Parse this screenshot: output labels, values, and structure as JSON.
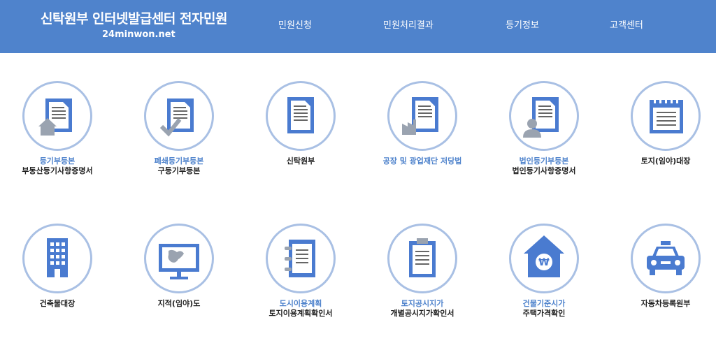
{
  "header": {
    "title": "신탁원부 인터넷발급센터 전자민원",
    "url": "24minwon.net",
    "nav": [
      "민원신청",
      "민원처리결과",
      "등기정보",
      "고객센터"
    ]
  },
  "services": [
    {
      "line1": "등기부등본",
      "line2": "부동산등기사항증명서",
      "icon": "house-document-icon"
    },
    {
      "line1": "폐쇄등기부등본",
      "line2": "구등기부등본",
      "icon": "checkmark-document-icon"
    },
    {
      "line1": "신탁원부",
      "line2": "",
      "icon": "document-icon"
    },
    {
      "line1": "공장 및 광업재단 저당법",
      "line2": "",
      "icon": "factory-document-icon"
    },
    {
      "line1": "법인등기부등본",
      "line2": "법인등기사항증명서",
      "icon": "person-document-icon"
    },
    {
      "line1": "토지(임야)대장",
      "line2": "",
      "icon": "notepad-icon"
    },
    {
      "line1": "건축물대장",
      "line2": "",
      "icon": "building-icon"
    },
    {
      "line1": "지적(임야)도",
      "line2": "",
      "icon": "map-monitor-icon"
    },
    {
      "line1": "도시이용계획",
      "line2": "토지이용계획확인서",
      "icon": "binder-icon"
    },
    {
      "line1": "토지공시지가",
      "line2": "개별공시지가확인서",
      "icon": "clipboard-icon"
    },
    {
      "line1": "건물기준시가",
      "line2": "주택가격확인",
      "icon": "house-won-icon"
    },
    {
      "line1": "자동차등록원부",
      "line2": "",
      "icon": "car-icon"
    }
  ],
  "colors": {
    "header": "#4f83cc",
    "accent": "#4f83cc",
    "ring": "#a9c0e4",
    "icon_fill": "#4a7bd0",
    "icon_gray": "#9aa3b0"
  }
}
